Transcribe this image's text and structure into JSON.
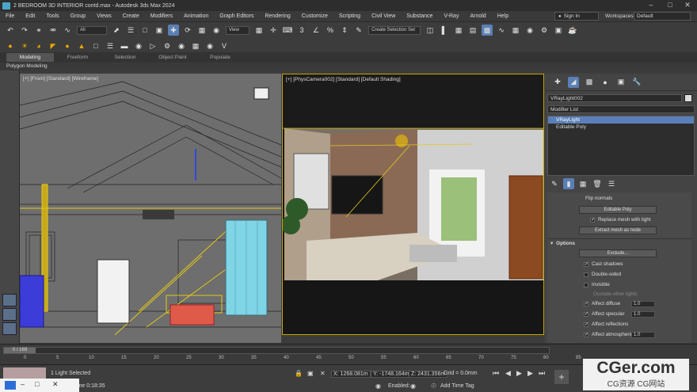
{
  "window": {
    "title": "2 BEDROOM 3D  INTERIOR contd.max - Autodesk 3ds Max 2024"
  },
  "menu": [
    "File",
    "Edit",
    "Tools",
    "Group",
    "Views",
    "Create",
    "Modifiers",
    "Animation",
    "Graph Editors",
    "Rendering",
    "Customize",
    "Scripting",
    "Civil View",
    "Substance",
    "V-Ray",
    "Arnold",
    "Help"
  ],
  "account": {
    "signin": "Sign In",
    "workspaces_label": "Workspaces:",
    "workspace": "Default"
  },
  "toolbar": {
    "filter": "All",
    "refcoord": "View",
    "selset": "Create Selection Set"
  },
  "ribbon": {
    "tabs": [
      "Modeling",
      "Freeform",
      "Selection",
      "Object Paint",
      "Populate"
    ],
    "active": "Modeling",
    "sub": "Polygon Modeling"
  },
  "viewports": {
    "front_label": "[+] [Front] [Standard] [Wireframe]",
    "cam_label": "[+] [PhysCamera002] [Standard] [Default Shading]"
  },
  "command_panel": {
    "object_name": "VRayLight002",
    "modifier_list": "Modifier List",
    "stack": [
      "VRayLight",
      "Editable Poly"
    ],
    "stack_active": "VRayLight",
    "flip_normals": "Flip normals",
    "editable_poly_btn": "Editable Poly",
    "replace_mesh": "Replace mesh with light",
    "extract_mesh_btn": "Extract mesh as node",
    "options_header": "Options",
    "exclude_btn": "Exclude...",
    "cast_shadows": "Cast shadows",
    "double_sided": "Double-sided",
    "invisible": "Invisible",
    "occlude": "Occlude other lights",
    "affect_diffuse": "Affect diffuse",
    "affect_specular": "Affect specular",
    "affect_reflections": "Affect reflections",
    "affect_atmosphere": "Affect atmospherics",
    "affect_diffuse_val": "1.0",
    "affect_specular_val": "1.0",
    "affect_atmo_val": "1.0"
  },
  "timeline": {
    "frame": "0 / 169",
    "ticks": [
      "0",
      "5",
      "10",
      "15",
      "20",
      "25",
      "30",
      "35",
      "40",
      "45",
      "50",
      "55",
      "60",
      "65",
      "70",
      "75",
      "80",
      "85"
    ]
  },
  "status": {
    "selected": "1 Light Selected",
    "time": "Time  0:18:35",
    "x": "X: 1268.081m",
    "y": "Y: -1748.164m",
    "z": "Z: 2431.356m",
    "grid": "Grid = 0.0mm",
    "enabled": "Enabled:",
    "add_time_tag": "Add Time Tag"
  },
  "watermark": {
    "line1": "CGer.com",
    "line2": "CG资源 CG网站"
  }
}
